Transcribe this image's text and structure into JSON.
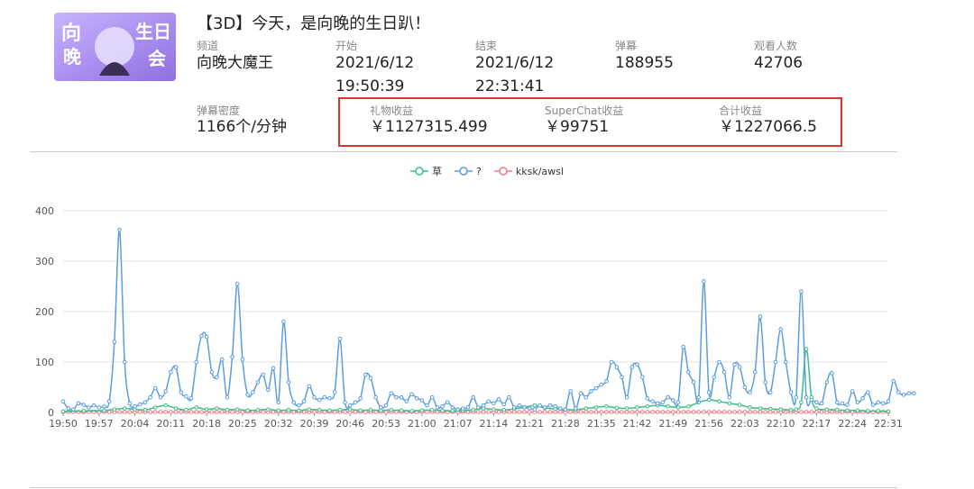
{
  "stream": {
    "title": "【3D】今天，是向晚的生日趴！",
    "channel_label": "频道",
    "channel": "向晚大魔王",
    "start_label": "开始",
    "start_date": "2021/6/12",
    "start_time": "19:50:39",
    "end_label": "结束",
    "end_date": "2021/6/12",
    "end_time": "22:31:41",
    "danmaku_label": "弹幕",
    "danmaku": "188955",
    "viewers_label": "观看人数",
    "viewers": "42706",
    "density_label": "弹幕密度",
    "density": "1166个/分钟",
    "gift_label": "礼物收益",
    "gift": "￥1127315.499",
    "sc_label": "SuperChat收益",
    "sc": "￥99751",
    "total_label": "合计收益",
    "total": "￥1227066.5",
    "thumbnail_text": "向晚生日会"
  },
  "colors": {
    "cao": "#3dbd8a",
    "q": "#5a9ee0",
    "kksk": "#ef7b86",
    "highlight_box": "#d9352f"
  },
  "chart_data": {
    "type": "line",
    "title": "",
    "xlabel": "",
    "ylabel": "",
    "ylim": [
      0,
      400
    ],
    "y_ticks": [
      0,
      100,
      200,
      300,
      400
    ],
    "x_ticks": [
      "19:50",
      "19:57",
      "20:04",
      "20:11",
      "20:18",
      "20:25",
      "20:32",
      "20:39",
      "20:46",
      "20:53",
      "21:00",
      "21:07",
      "21:14",
      "21:21",
      "21:28",
      "21:35",
      "21:42",
      "21:49",
      "21:56",
      "22:03",
      "22:10",
      "22:17",
      "22:24",
      "22:31"
    ],
    "x_range_minutes": [
      0,
      161
    ],
    "grid": "horizontal",
    "legend": "top-center",
    "series": [
      {
        "name": "草",
        "key": "cao",
        "points": [
          [
            0,
            2
          ],
          [
            4,
            3
          ],
          [
            8,
            4
          ],
          [
            10,
            6
          ],
          [
            12,
            8
          ],
          [
            14,
            6
          ],
          [
            16,
            5
          ],
          [
            18,
            10
          ],
          [
            20,
            14
          ],
          [
            22,
            8
          ],
          [
            24,
            5
          ],
          [
            26,
            10
          ],
          [
            28,
            6
          ],
          [
            30,
            8
          ],
          [
            32,
            5
          ],
          [
            34,
            6
          ],
          [
            36,
            4
          ],
          [
            38,
            5
          ],
          [
            40,
            6
          ],
          [
            42,
            4
          ],
          [
            44,
            5
          ],
          [
            46,
            4
          ],
          [
            48,
            6
          ],
          [
            50,
            5
          ],
          [
            52,
            4
          ],
          [
            54,
            5
          ],
          [
            56,
            6
          ],
          [
            58,
            4
          ],
          [
            60,
            5
          ],
          [
            62,
            4
          ],
          [
            64,
            5
          ],
          [
            66,
            4
          ],
          [
            68,
            3
          ],
          [
            70,
            4
          ],
          [
            72,
            5
          ],
          [
            74,
            4
          ],
          [
            76,
            3
          ],
          [
            78,
            4
          ],
          [
            80,
            5
          ],
          [
            82,
            8
          ],
          [
            84,
            6
          ],
          [
            86,
            5
          ],
          [
            88,
            7
          ],
          [
            90,
            10
          ],
          [
            92,
            14
          ],
          [
            94,
            9
          ],
          [
            96,
            7
          ],
          [
            98,
            6
          ],
          [
            100,
            5
          ],
          [
            102,
            8
          ],
          [
            104,
            10
          ],
          [
            106,
            12
          ],
          [
            108,
            9
          ],
          [
            110,
            8
          ],
          [
            112,
            10
          ],
          [
            114,
            12
          ],
          [
            116,
            14
          ],
          [
            118,
            12
          ],
          [
            120,
            10
          ],
          [
            122,
            12
          ],
          [
            124,
            20
          ],
          [
            126,
            25
          ],
          [
            128,
            22
          ],
          [
            130,
            18
          ],
          [
            132,
            15
          ],
          [
            134,
            10
          ],
          [
            136,
            8
          ],
          [
            138,
            7
          ],
          [
            140,
            6
          ],
          [
            142,
            5
          ],
          [
            143,
            6
          ],
          [
            144,
            20
          ],
          [
            145,
            126
          ],
          [
            146,
            30
          ],
          [
            147,
            8
          ],
          [
            149,
            6
          ],
          [
            151,
            5
          ],
          [
            153,
            4
          ],
          [
            155,
            4
          ],
          [
            157,
            3
          ],
          [
            159,
            3
          ],
          [
            161,
            2
          ]
        ]
      },
      {
        "name": "?",
        "key": "q",
        "points": [
          [
            0,
            22
          ],
          [
            1,
            8
          ],
          [
            2,
            6
          ],
          [
            3,
            18
          ],
          [
            4,
            15
          ],
          [
            5,
            10
          ],
          [
            6,
            14
          ],
          [
            7,
            10
          ],
          [
            8,
            12
          ],
          [
            9,
            22
          ],
          [
            10,
            140
          ],
          [
            11,
            362
          ],
          [
            12,
            100
          ],
          [
            13,
            18
          ],
          [
            14,
            12
          ],
          [
            15,
            16
          ],
          [
            16,
            20
          ],
          [
            17,
            30
          ],
          [
            18,
            48
          ],
          [
            19,
            30
          ],
          [
            20,
            42
          ],
          [
            21,
            80
          ],
          [
            22,
            90
          ],
          [
            23,
            40
          ],
          [
            24,
            32
          ],
          [
            25,
            28
          ],
          [
            26,
            100
          ],
          [
            27,
            152
          ],
          [
            28,
            150
          ],
          [
            29,
            80
          ],
          [
            30,
            70
          ],
          [
            31,
            105
          ],
          [
            32,
            30
          ],
          [
            33,
            110
          ],
          [
            34,
            255
          ],
          [
            35,
            105
          ],
          [
            36,
            35
          ],
          [
            37,
            40
          ],
          [
            38,
            60
          ],
          [
            39,
            75
          ],
          [
            40,
            45
          ],
          [
            41,
            88
          ],
          [
            42,
            20
          ],
          [
            43,
            180
          ],
          [
            44,
            60
          ],
          [
            45,
            20
          ],
          [
            46,
            14
          ],
          [
            47,
            22
          ],
          [
            48,
            52
          ],
          [
            49,
            30
          ],
          [
            50,
            25
          ],
          [
            51,
            30
          ],
          [
            52,
            28
          ],
          [
            53,
            40
          ],
          [
            54,
            146
          ],
          [
            55,
            20
          ],
          [
            56,
            14
          ],
          [
            57,
            20
          ],
          [
            58,
            28
          ],
          [
            59,
            75
          ],
          [
            60,
            68
          ],
          [
            61,
            30
          ],
          [
            62,
            10
          ],
          [
            63,
            14
          ],
          [
            64,
            38
          ],
          [
            65,
            30
          ],
          [
            66,
            30
          ],
          [
            67,
            22
          ],
          [
            68,
            36
          ],
          [
            69,
            28
          ],
          [
            70,
            24
          ],
          [
            71,
            14
          ],
          [
            72,
            30
          ],
          [
            73,
            10
          ],
          [
            74,
            12
          ],
          [
            75,
            20
          ],
          [
            76,
            10
          ],
          [
            77,
            6
          ],
          [
            78,
            8
          ],
          [
            79,
            10
          ],
          [
            80,
            30
          ],
          [
            81,
            10
          ],
          [
            82,
            14
          ],
          [
            83,
            22
          ],
          [
            84,
            18
          ],
          [
            85,
            26
          ],
          [
            86,
            16
          ],
          [
            87,
            30
          ],
          [
            88,
            10
          ],
          [
            89,
            14
          ],
          [
            90,
            10
          ],
          [
            91,
            8
          ],
          [
            92,
            6
          ],
          [
            93,
            14
          ],
          [
            94,
            10
          ],
          [
            95,
            14
          ],
          [
            96,
            12
          ],
          [
            97,
            8
          ],
          [
            98,
            6
          ],
          [
            99,
            42
          ],
          [
            100,
            8
          ],
          [
            101,
            38
          ],
          [
            102,
            30
          ],
          [
            103,
            42
          ],
          [
            104,
            48
          ],
          [
            105,
            55
          ],
          [
            106,
            62
          ],
          [
            107,
            100
          ],
          [
            108,
            90
          ],
          [
            109,
            70
          ],
          [
            110,
            30
          ],
          [
            111,
            90
          ],
          [
            112,
            95
          ],
          [
            113,
            70
          ],
          [
            114,
            28
          ],
          [
            115,
            22
          ],
          [
            116,
            18
          ],
          [
            117,
            20
          ],
          [
            118,
            30
          ],
          [
            119,
            24
          ],
          [
            120,
            20
          ],
          [
            121,
            130
          ],
          [
            122,
            80
          ],
          [
            123,
            60
          ],
          [
            124,
            30
          ],
          [
            125,
            260
          ],
          [
            126,
            40
          ],
          [
            127,
            70
          ],
          [
            128,
            100
          ],
          [
            129,
            80
          ],
          [
            130,
            30
          ],
          [
            131,
            95
          ],
          [
            132,
            90
          ],
          [
            133,
            50
          ],
          [
            134,
            40
          ],
          [
            135,
            80
          ],
          [
            136,
            190
          ],
          [
            137,
            60
          ],
          [
            138,
            40
          ],
          [
            139,
            100
          ],
          [
            140,
            165
          ],
          [
            141,
            100
          ],
          [
            142,
            40
          ],
          [
            143,
            30
          ],
          [
            144,
            240
          ],
          [
            145,
            30
          ],
          [
            146,
            25
          ],
          [
            147,
            20
          ],
          [
            148,
            18
          ],
          [
            149,
            60
          ],
          [
            150,
            78
          ],
          [
            151,
            20
          ],
          [
            152,
            18
          ],
          [
            153,
            15
          ],
          [
            154,
            42
          ],
          [
            155,
            20
          ],
          [
            156,
            28
          ],
          [
            157,
            40
          ],
          [
            158,
            15
          ],
          [
            159,
            20
          ],
          [
            160,
            18
          ],
          [
            161,
            22
          ],
          [
            162,
            62
          ],
          [
            163,
            40
          ],
          [
            164,
            35
          ],
          [
            165,
            38
          ],
          [
            166,
            38
          ]
        ]
      },
      {
        "name": "kksk/awsl",
        "key": "kksk",
        "points": [
          [
            0,
            1
          ],
          [
            20,
            1
          ],
          [
            40,
            1
          ],
          [
            60,
            1
          ],
          [
            80,
            1
          ],
          [
            100,
            1
          ],
          [
            120,
            1
          ],
          [
            140,
            1
          ],
          [
            161,
            1
          ]
        ]
      }
    ]
  }
}
